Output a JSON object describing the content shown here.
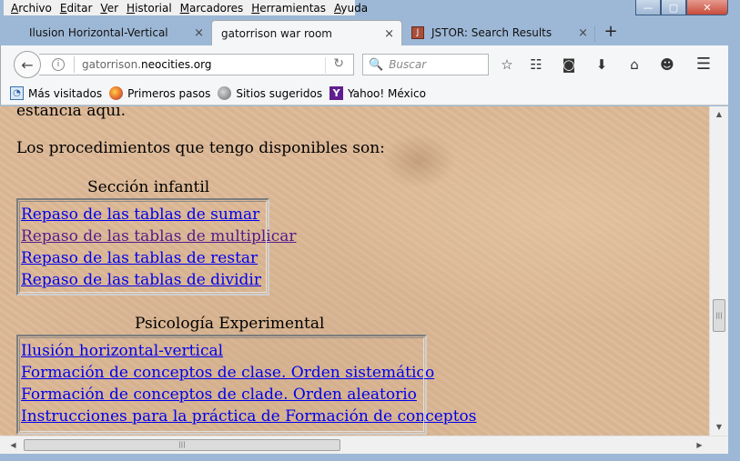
{
  "menu": [
    {
      "label": "Archivo",
      "accel": "A",
      "rest": "rchivo"
    },
    {
      "label": "Editar",
      "accel": "E",
      "rest": "ditar"
    },
    {
      "label": "Ver",
      "accel": "V",
      "rest": "er"
    },
    {
      "label": "Historial",
      "accel": "H",
      "rest": "istorial"
    },
    {
      "label": "Marcadores",
      "accel": "M",
      "rest": "arcadores"
    },
    {
      "label": "Herramientas",
      "accel": "H",
      "rest": "erramientas"
    },
    {
      "label": "Ayuda",
      "accel": "A",
      "rest": "yuda"
    }
  ],
  "window_controls": {
    "minimize": "—",
    "maximize": "▢",
    "close": "✕"
  },
  "tabs": [
    {
      "title": "Ilusion Horizontal-Vertical",
      "active": false
    },
    {
      "title": "gatorrison war room",
      "active": true
    },
    {
      "title": "JSTOR: Search Results",
      "active": false
    }
  ],
  "tab_close": "×",
  "new_tab": "+",
  "jstor_icon_letter": "J",
  "nav": {
    "back": "←",
    "info": "i",
    "url_prefix": "gatorrison.",
    "url_domain": "neocities.org",
    "reload": "↻",
    "search_glyph": "🔍",
    "search_placeholder": "Buscar",
    "icons": {
      "bookmark_star": "☆",
      "reading_list": "☷",
      "pocket": "◙",
      "download": "⬇",
      "home": "⌂",
      "hello": "☻",
      "menu": "☰"
    }
  },
  "bookmarks": [
    {
      "label": "Más visitados",
      "icon": "favorites-icon"
    },
    {
      "label": "Primeros pasos",
      "icon": "firefox-icon"
    },
    {
      "label": "Sitios sugeridos",
      "icon": "globe-icon"
    },
    {
      "label": "Yahoo! México",
      "icon": "yahoo-icon",
      "glyph": "Y"
    }
  ],
  "content": {
    "intro_tail": "estancia aquí.",
    "procedures_intro": "Los procedimientos que tengo disponibles son:",
    "section1": {
      "title": "Sección infantil",
      "links": [
        {
          "text": "Repaso de las tablas de sumar",
          "visited": false
        },
        {
          "text": "Repaso de las tablas de multiplicar",
          "visited": true
        },
        {
          "text": "Repaso de las tablas de restar",
          "visited": false
        },
        {
          "text": "Repaso de las tablas de dividir",
          "visited": false
        }
      ]
    },
    "section2": {
      "title": "Psicología Experimental",
      "links": [
        {
          "text": "Ilusión horizontal-vertical",
          "visited": false
        },
        {
          "text": "Formación de conceptos de clase. Orden sistemático",
          "visited": false
        },
        {
          "text": "Formación de conceptos de clade. Orden aleatorio",
          "visited": false
        },
        {
          "text": "Instrucciones para la práctica de Formación de conceptos",
          "visited": false
        }
      ]
    }
  },
  "scroll": {
    "up": "▲",
    "down": "▼",
    "left": "◀",
    "right": "▶",
    "grip": "|||",
    "vertical_position": 0.55,
    "horizontal_position": 0.0
  }
}
